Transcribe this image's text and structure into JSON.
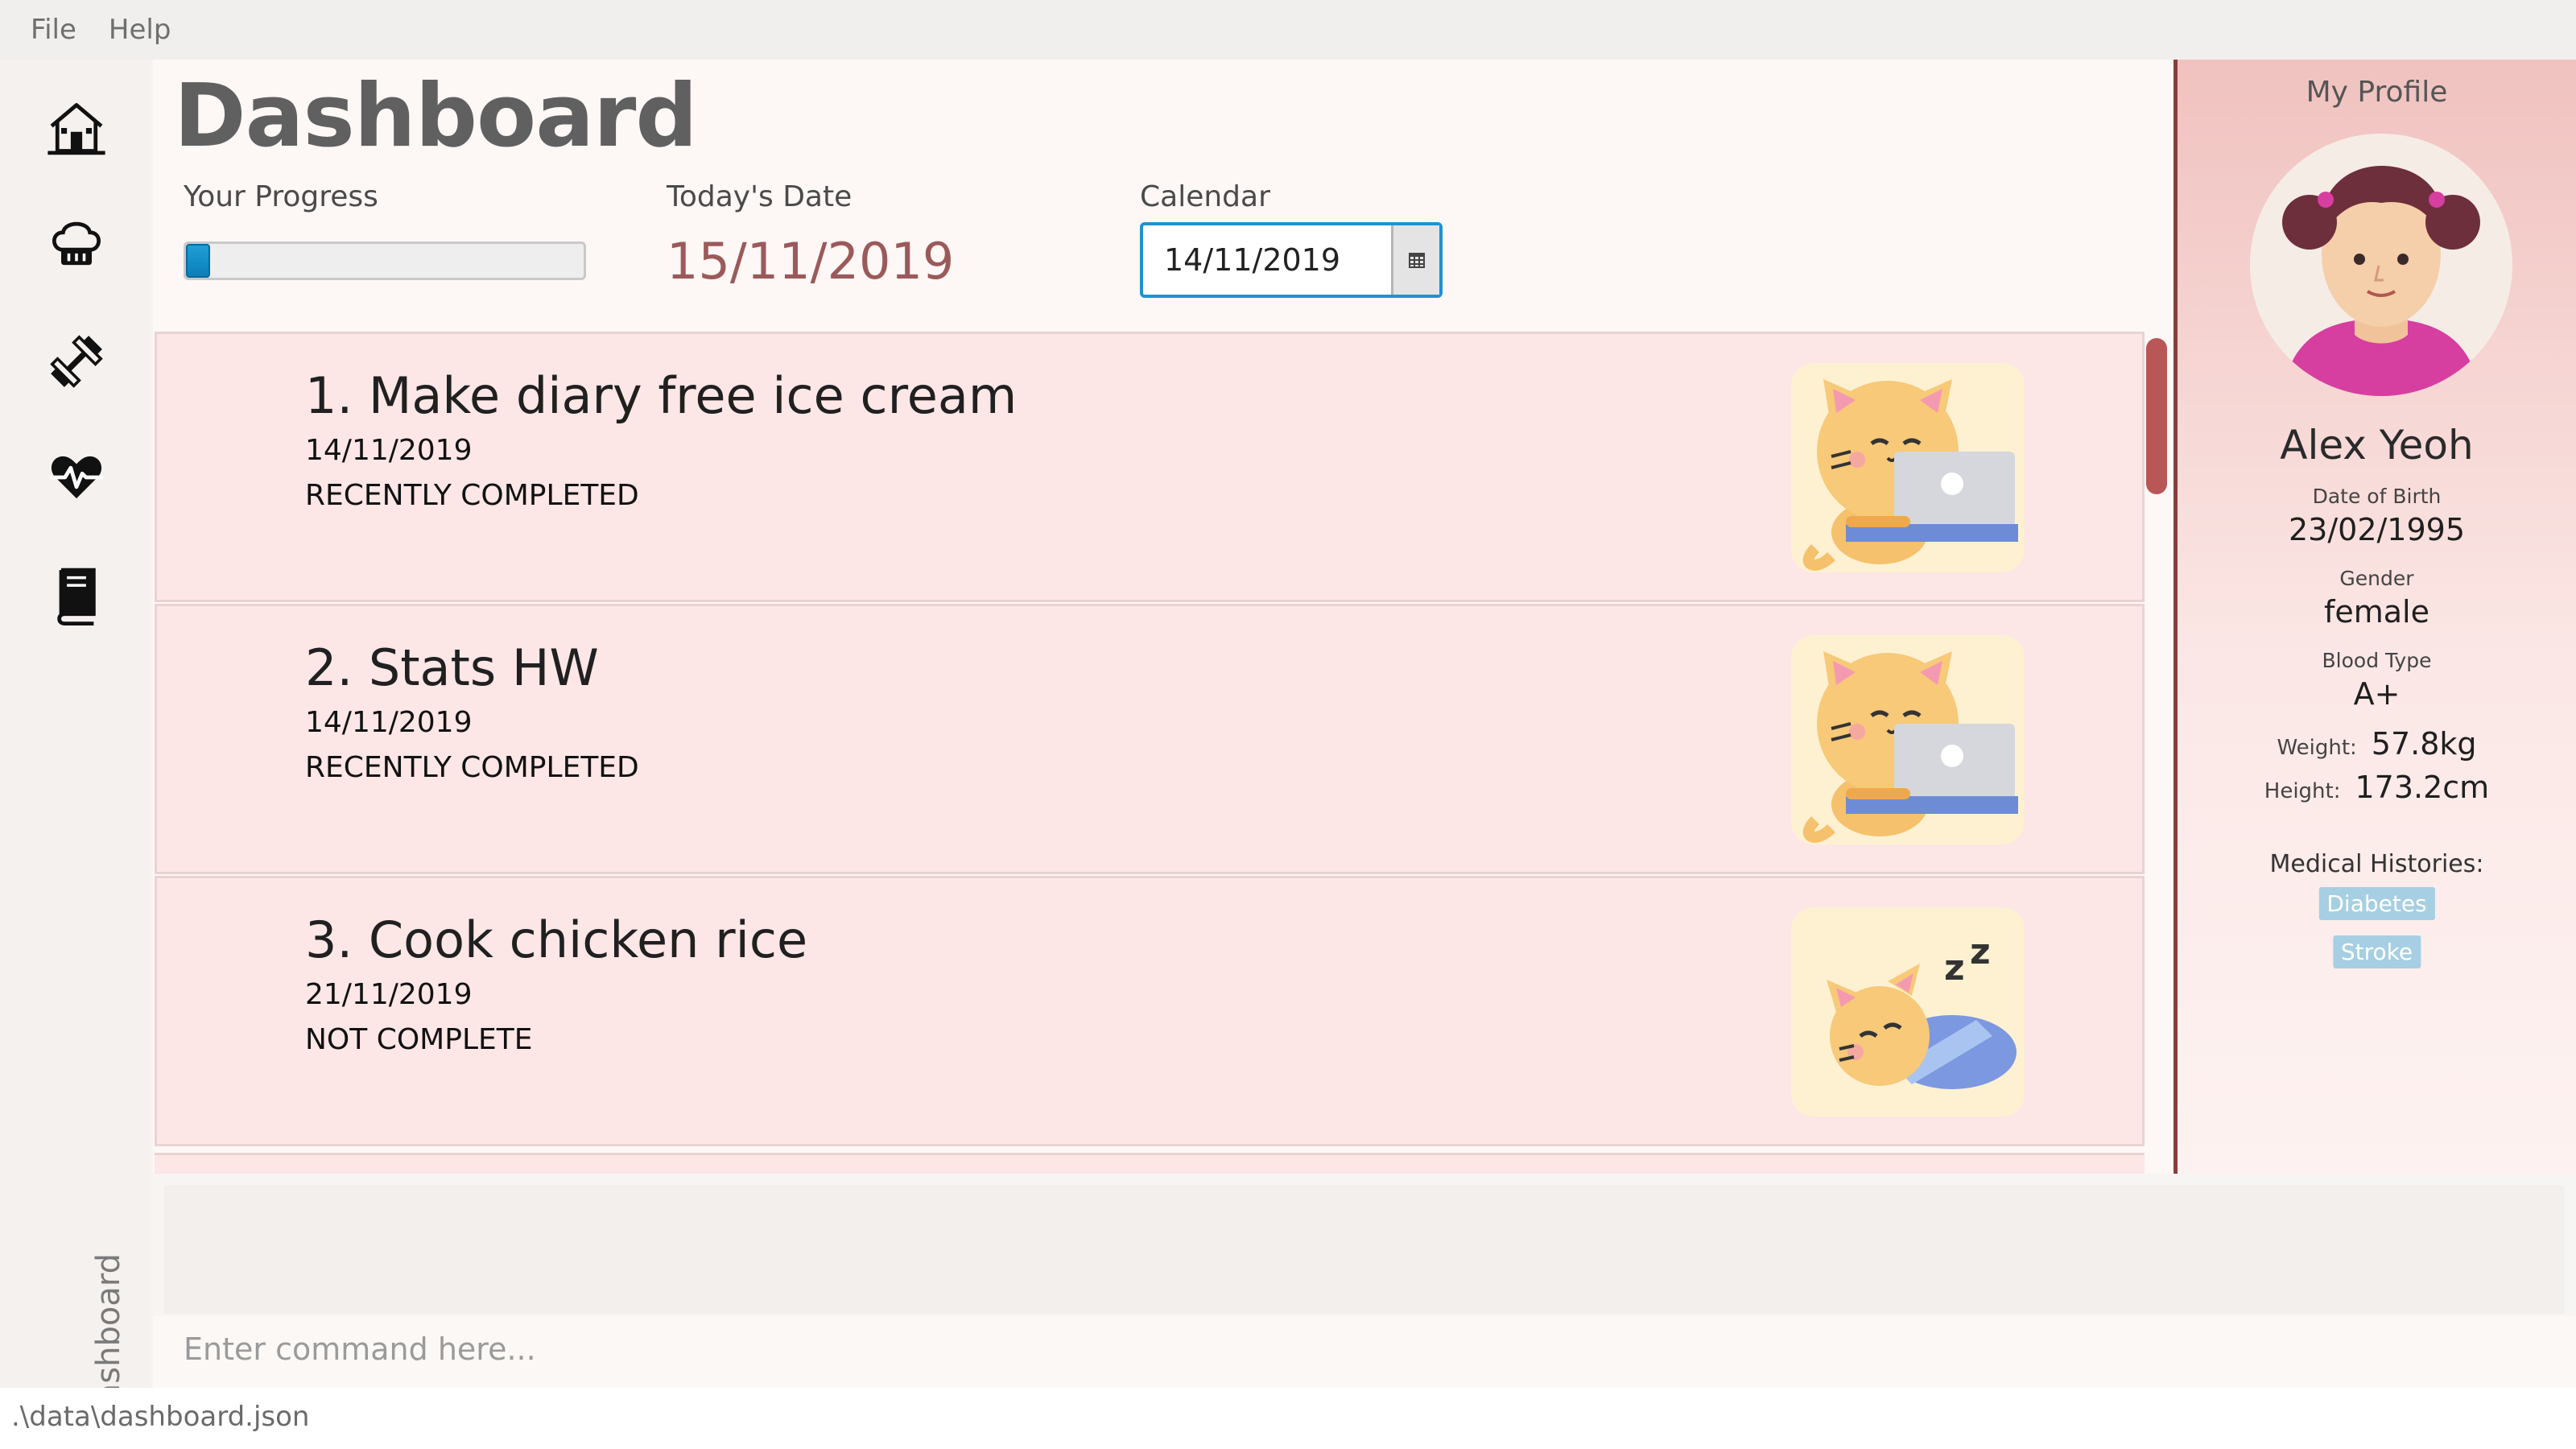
{
  "menu": {
    "items": [
      "File",
      "Help"
    ]
  },
  "sidebar": {
    "buttons": [
      "home-icon",
      "chef-hat-icon",
      "dumbbell-icon",
      "heartbeat-icon",
      "book-icon"
    ],
    "active_label": "Dashboard"
  },
  "dashboard": {
    "title": "Dashboard",
    "progress_label": "Your Progress",
    "progress_fraction": 0.06,
    "today_label": "Today's Date",
    "today_value": "15/11/2019",
    "calendar_label": "Calendar",
    "calendar_value": "14/11/2019",
    "calendar_icon": "calendar-icon"
  },
  "tasks": [
    {
      "title": "1.  Make diary free ice cream",
      "date": "14/11/2019",
      "status": "RECENTLY COMPLETED",
      "image": "cat-laptop-icon"
    },
    {
      "title": "2.  Stats HW",
      "date": "14/11/2019",
      "status": "RECENTLY COMPLETED",
      "image": "cat-laptop-icon"
    },
    {
      "title": "3.  Cook chicken rice",
      "date": "21/11/2019",
      "status": "NOT COMPLETE",
      "image": "cat-sleeping-icon"
    }
  ],
  "profile": {
    "heading": "My Profile",
    "avatar": "avatar-girl-icon",
    "name": "Alex Yeoh",
    "dob_label": "Date of Birth",
    "dob": "23/02/1995",
    "gender_label": "Gender",
    "gender": "female",
    "blood_label": "Blood Type",
    "blood": "A+",
    "weight_label": "Weight:",
    "weight": "57.8kg",
    "height_label": "Height:",
    "height": "173.2cm",
    "medical_label": "Medical Histories:",
    "medical": [
      "Diabetes",
      "Stroke"
    ]
  },
  "command": {
    "placeholder": "Enter command here..."
  },
  "status": {
    "path": ".\\data\\dashboard.json"
  },
  "colors": {
    "accent": "#1d93d2",
    "profile_border": "#8a3d3d",
    "card_bg": "#fde6e6",
    "date_red": "#9b5a5a"
  }
}
